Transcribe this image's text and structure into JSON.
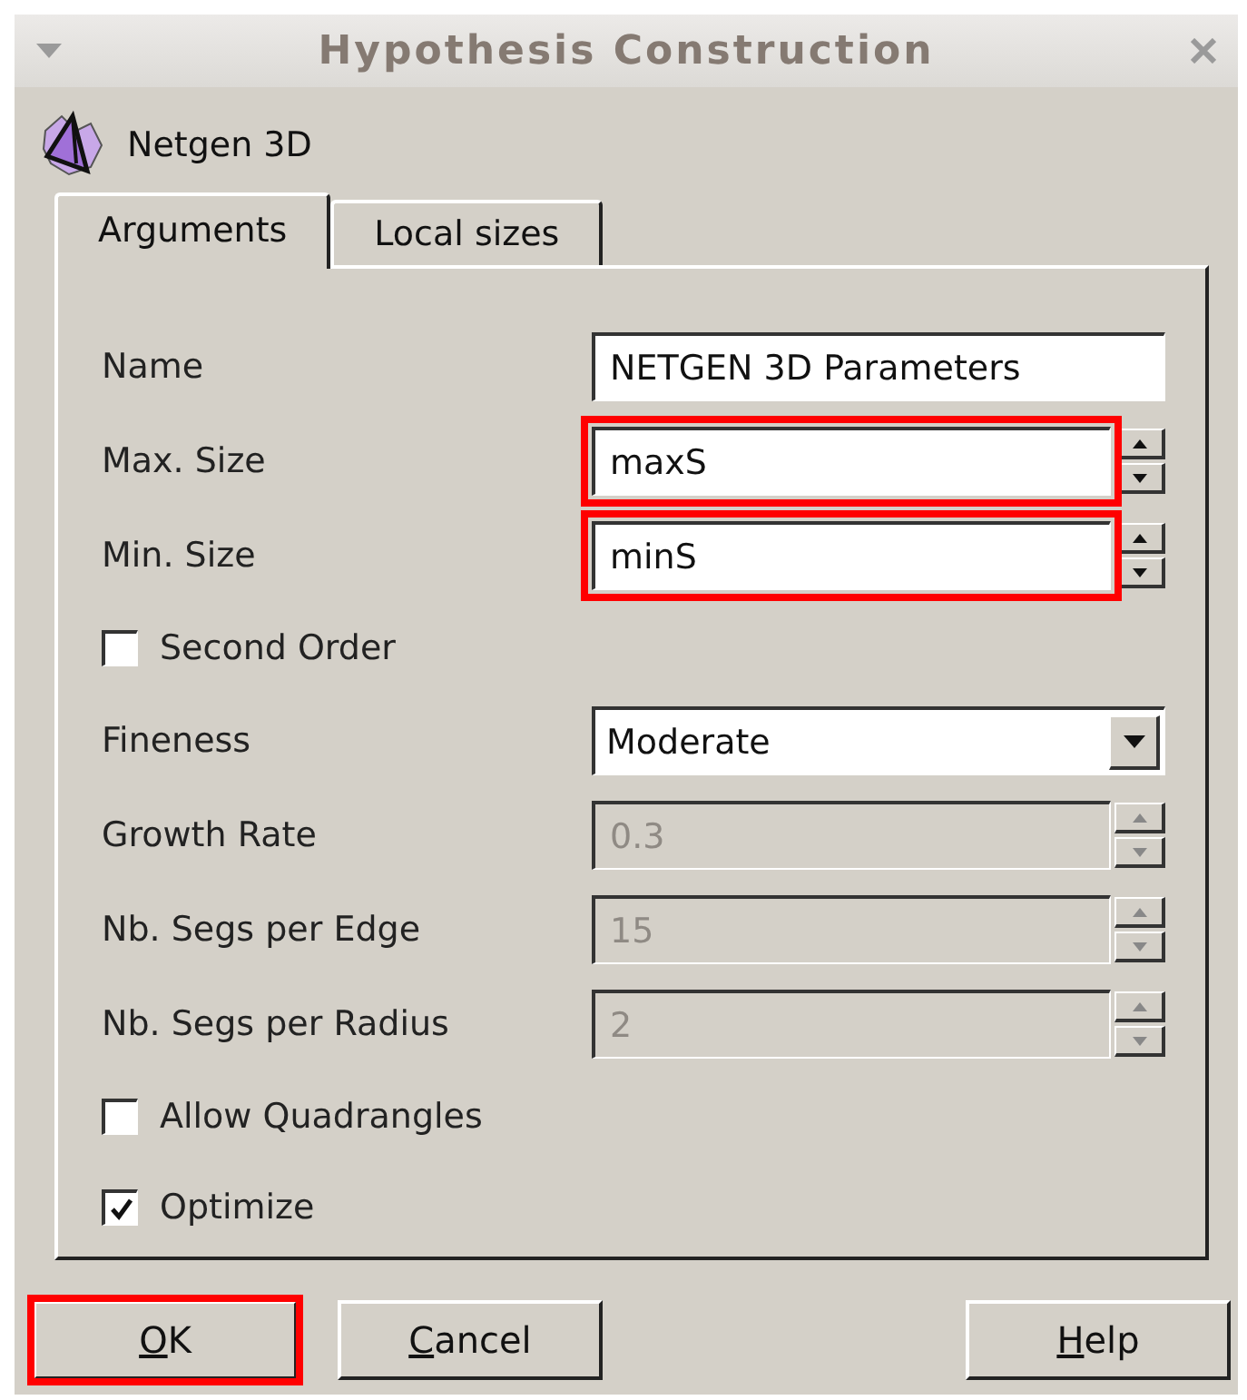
{
  "window": {
    "title": "Hypothesis Construction"
  },
  "header": {
    "label": "Netgen 3D"
  },
  "tabs": [
    {
      "label": "Arguments",
      "selected": true
    },
    {
      "label": "Local sizes",
      "selected": false
    }
  ],
  "rows": [
    {
      "kind": "text",
      "label": "Name",
      "value": "NETGEN 3D Parameters",
      "disabled": false
    },
    {
      "kind": "spin",
      "label": "Max. Size",
      "value": "maxS",
      "disabled": false,
      "highlighted": true
    },
    {
      "kind": "spin",
      "label": "Min. Size",
      "value": "minS",
      "disabled": false,
      "highlighted": true
    },
    {
      "kind": "check",
      "label": "Second Order",
      "checked": false
    },
    {
      "kind": "combo",
      "label": "Fineness",
      "value": "Moderate",
      "disabled": false
    },
    {
      "kind": "spin",
      "label": "Growth Rate",
      "value": "0.3",
      "disabled": true
    },
    {
      "kind": "spin",
      "label": "Nb. Segs per Edge",
      "value": "15",
      "disabled": true
    },
    {
      "kind": "spin",
      "label": "Nb. Segs per Radius",
      "value": "2",
      "disabled": true
    },
    {
      "kind": "check",
      "label": "Allow Quadrangles",
      "checked": false
    },
    {
      "kind": "check",
      "label": "Optimize",
      "checked": true
    }
  ],
  "buttons": [
    {
      "label": "OK",
      "underline_first": true,
      "highlighted": true
    },
    {
      "label": "Cancel",
      "underline_first": true,
      "highlighted": false
    },
    {
      "label": "Help",
      "underline_first": true,
      "highlighted": false
    }
  ]
}
